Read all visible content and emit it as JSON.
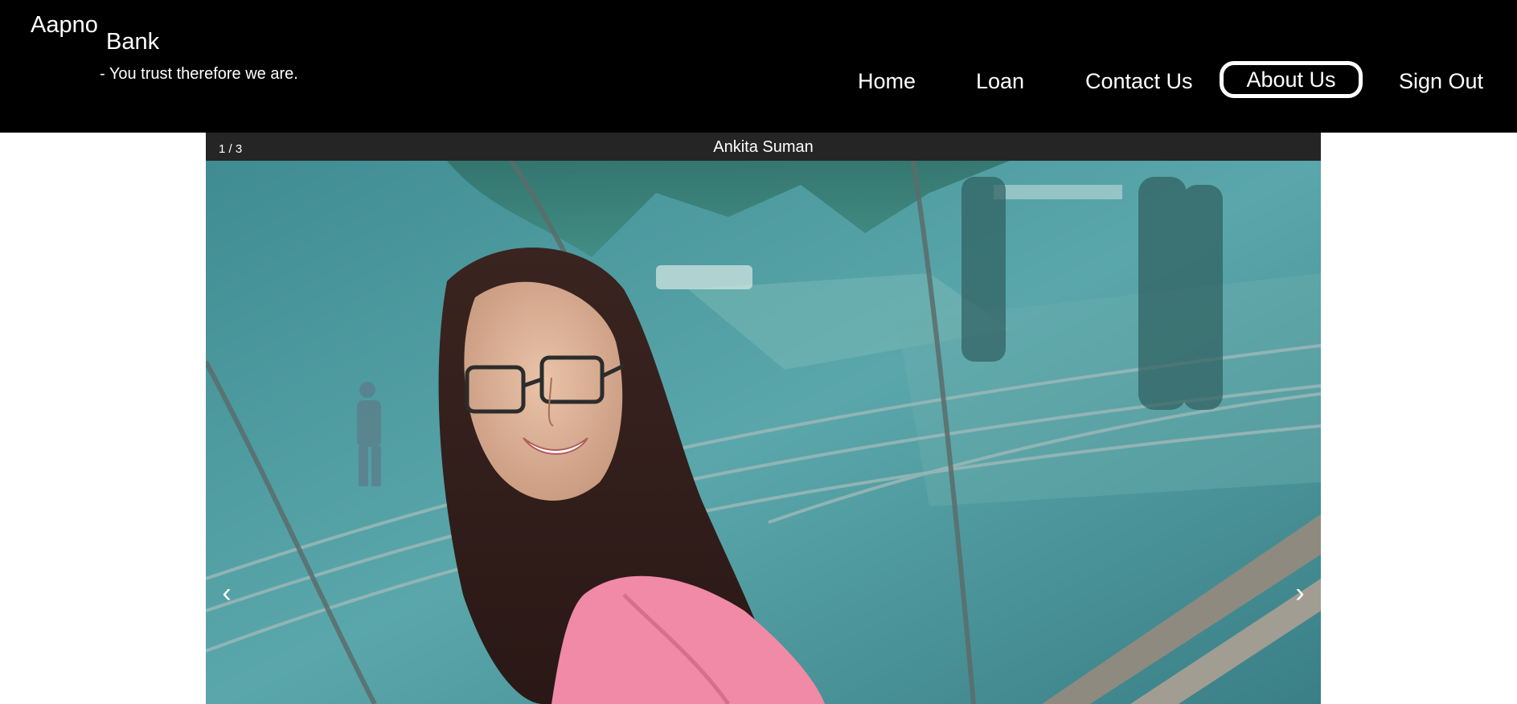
{
  "brand": {
    "name_line1": "Aapno",
    "name_line2": "Bank",
    "tagline": "- You trust therefore we are."
  },
  "nav": {
    "home": "Home",
    "loan": "Loan",
    "contact": "Contact Us",
    "about": "About Us",
    "signout": "Sign Out",
    "active": "About Us"
  },
  "slideshow": {
    "counter": "1 / 3",
    "caption": "Ankita Suman",
    "prev_arrow": "‹",
    "next_arrow": "›",
    "photo_subject": "smiling woman with glasses in pink top near glass railing"
  },
  "colors": {
    "header_bg": "#000000",
    "header_text": "#ffffff",
    "slider_bar": "#252525",
    "photo_tint": "#4f9ea3",
    "shirt_pink": "#f08aa6"
  }
}
